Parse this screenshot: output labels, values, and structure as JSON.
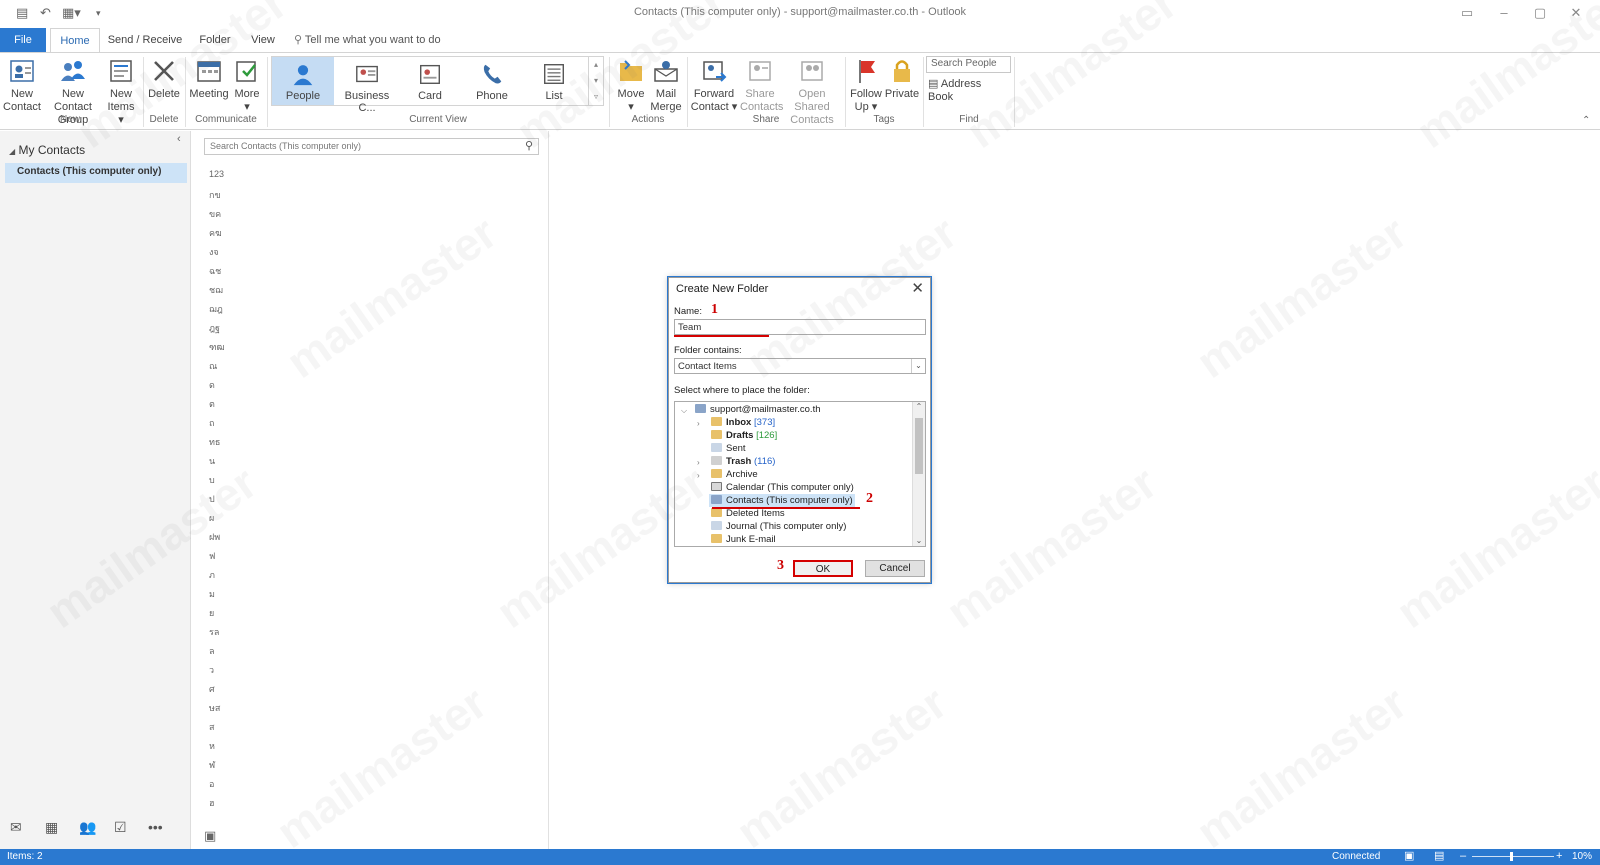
{
  "window": {
    "title": "Contacts (This computer only) - support@mailmaster.co.th  -  Outlook"
  },
  "tabs": {
    "file": "File",
    "home": "Home",
    "send_receive": "Send / Receive",
    "folder": "Folder",
    "view": "View",
    "tell_me": "Tell me what you want to do"
  },
  "ribbon": {
    "new_contact": [
      "New",
      "Contact"
    ],
    "new_contact_group": [
      "New Contact",
      "Group"
    ],
    "new_items": [
      "New",
      "Items"
    ],
    "delete": "Delete",
    "meeting": "Meeting",
    "more": "More",
    "views": [
      "People",
      "Business C...",
      "Card",
      "Phone",
      "List"
    ],
    "move": "Move",
    "mail_merge": [
      "Mail",
      "Merge"
    ],
    "forward_contact": [
      "Forward",
      "Contact"
    ],
    "share_contacts": [
      "Share",
      "Contacts"
    ],
    "open_shared_contacts": [
      "Open Shared",
      "Contacts"
    ],
    "follow_up": [
      "Follow",
      "Up"
    ],
    "private": "Private",
    "search_people": "Search People",
    "address_book": "Address Book",
    "groups": {
      "new": "New",
      "delete": "Delete",
      "communicate": "Communicate",
      "current_view": "Current View",
      "actions": "Actions",
      "share": "Share",
      "tags": "Tags",
      "find": "Find"
    }
  },
  "nav": {
    "my_contacts": "My Contacts",
    "selected_folder": "Contacts (This computer only)"
  },
  "contacts": {
    "search_placeholder": "Search Contacts (This computer only)",
    "index": [
      "123",
      "กข",
      "ขค",
      "คฆ",
      "งจ",
      "ฉช",
      "ชฌ",
      "ฌฎ",
      "ฎฐ",
      "ฑฒ",
      "ณ",
      "ด",
      "ต",
      "ถ",
      "ทธ",
      "น",
      "บ",
      "ป",
      "ผ",
      "ฝพ",
      "ฟ",
      "ภ",
      "ม",
      "ย",
      "รล",
      "ล",
      "ว",
      "ศ",
      "ษส",
      "ส",
      "ห",
      "ฬ",
      "อ",
      "ฮ"
    ]
  },
  "dialog": {
    "title": "Create New Folder",
    "name_label": "Name:",
    "name_value": "Team",
    "contains_label": "Folder contains:",
    "contains_value": "Contact Items",
    "place_label": "Select where to place the folder:",
    "tree": {
      "root": "support@mailmaster.co.th",
      "inbox": "Inbox",
      "inbox_count": "[373]",
      "drafts": "Drafts",
      "drafts_count": "[126]",
      "sent": "Sent",
      "trash": "Trash",
      "trash_count": "(116)",
      "archive": "Archive",
      "calendar": "Calendar (This computer only)",
      "contacts": "Contacts (This computer only)",
      "deleted_items": "Deleted Items",
      "journal": "Journal (This computer only)",
      "junk": "Junk E-mail"
    },
    "ok": "OK",
    "cancel": "Cancel",
    "markers": [
      "1",
      "2",
      "3"
    ]
  },
  "status": {
    "items": "Items: 2",
    "connected": "Connected",
    "zoom": "10%"
  },
  "watermark": "mailmaster"
}
